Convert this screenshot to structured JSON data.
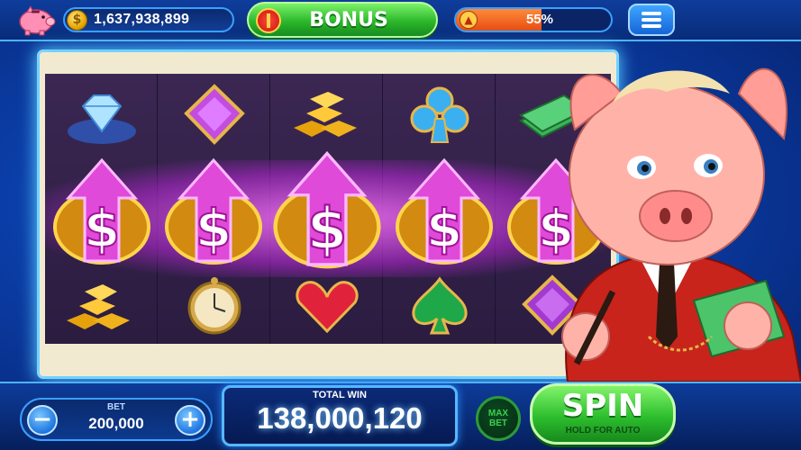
{
  "header": {
    "coins": "1,637,938,899",
    "bonus_label": "BONUS",
    "level_progress_text": "55%",
    "level_progress": 0.55
  },
  "reels": {
    "top_row": [
      "diamond-icon",
      "purple-gem-icon",
      "gold-bars-icon",
      "blue-club-icon",
      "cash-stack-icon"
    ],
    "win_row": [
      "dollar-arrow-icon",
      "dollar-arrow-icon",
      "dollar-arrow-icon",
      "dollar-arrow-icon",
      "dollar-arrow-icon"
    ],
    "bottom_row": [
      "gold-bars-icon",
      "pocket-watch-icon",
      "red-heart-icon",
      "green-spade-icon",
      "purple-gem-icon"
    ]
  },
  "footer": {
    "bet_label": "BET",
    "bet_value": "200,000",
    "minus_label": "−",
    "plus_label": "+",
    "total_win_label": "TOTAL WIN",
    "total_win_value": "138,000,120",
    "max_bet_label": "MAX BET",
    "spin_label": "SPIN",
    "spin_sub_label": "HOLD FOR AUTO"
  },
  "colors": {
    "accent_green": "#2cb82c",
    "accent_blue": "#3aa0ff",
    "win_glow": "#e05cf0"
  }
}
